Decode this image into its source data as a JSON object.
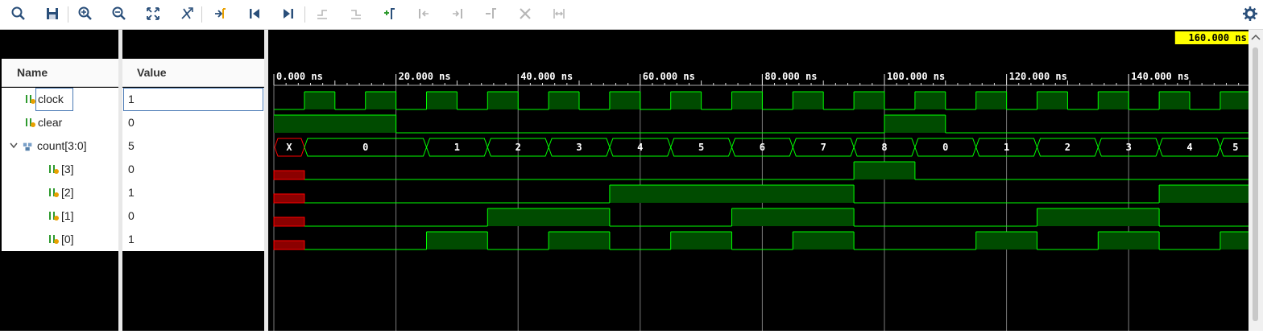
{
  "toolbar": {
    "icons": [
      "search-icon",
      "save-icon",
      "zoom-in-icon",
      "zoom-out-icon",
      "zoom-fit-icon",
      "cursor-to-zoom-icon",
      "go-to-time-zero-icon",
      "go-to-first-icon",
      "go-to-last-icon",
      "previous-transition-icon",
      "next-transition-icon",
      "add-marker-icon",
      "previous-marker-icon",
      "next-marker-icon",
      "swap-cursors-icon",
      "delete-marker-icon",
      "snap-icon",
      "settings-gear-icon"
    ]
  },
  "headers": {
    "name": "Name",
    "value": "Value"
  },
  "signals": [
    {
      "name": "clock",
      "value": "1",
      "type": "bit"
    },
    {
      "name": "clear",
      "value": "0",
      "type": "bit"
    },
    {
      "name": "count[3:0]",
      "value": "5",
      "type": "bus"
    },
    {
      "name": "[3]",
      "value": "0",
      "type": "bit"
    },
    {
      "name": "[2]",
      "value": "1",
      "type": "bit"
    },
    {
      "name": "[1]",
      "value": "0",
      "type": "bit"
    },
    {
      "name": "[0]",
      "value": "1",
      "type": "bit"
    }
  ],
  "waveform": {
    "cursor_label": "160.000 ns",
    "time_unit": "ns",
    "range_ns": [
      0,
      160
    ],
    "time_labels": [
      "0.000 ns",
      "20.000 ns",
      "40.000 ns",
      "60.000 ns",
      "80.000 ns",
      "100.000 ns",
      "120.000 ns",
      "140.000 ns"
    ],
    "time_label_values_ns": [
      0,
      20,
      40,
      60,
      80,
      100,
      120,
      140
    ],
    "clock_period_ns": 10,
    "clock_first_rise_ns": 5,
    "clear_high_intervals_ns": [
      [
        0,
        20
      ],
      [
        100,
        110
      ]
    ],
    "count_segments": [
      {
        "start": 0,
        "end": 5,
        "label": "X"
      },
      {
        "start": 5,
        "end": 25,
        "label": "0"
      },
      {
        "start": 25,
        "end": 35,
        "label": "1"
      },
      {
        "start": 35,
        "end": 45,
        "label": "2"
      },
      {
        "start": 45,
        "end": 55,
        "label": "3"
      },
      {
        "start": 55,
        "end": 65,
        "label": "4"
      },
      {
        "start": 65,
        "end": 75,
        "label": "5"
      },
      {
        "start": 75,
        "end": 85,
        "label": "6"
      },
      {
        "start": 85,
        "end": 95,
        "label": "7"
      },
      {
        "start": 95,
        "end": 105,
        "label": "8"
      },
      {
        "start": 105,
        "end": 115,
        "label": "0"
      },
      {
        "start": 115,
        "end": 125,
        "label": "1"
      },
      {
        "start": 125,
        "end": 135,
        "label": "2"
      },
      {
        "start": 135,
        "end": 145,
        "label": "3"
      },
      {
        "start": 145,
        "end": 155,
        "label": "4"
      },
      {
        "start": 155,
        "end": 160,
        "label": "5"
      }
    ],
    "colors": {
      "wave": "#00ff00",
      "fill": "#004b00",
      "unknown": "#ff0000",
      "unknown_fill": "#8b0000",
      "cursor_label_bg": "#ffff00",
      "grid": "#7a7a7a",
      "text": "#ffffff"
    }
  }
}
